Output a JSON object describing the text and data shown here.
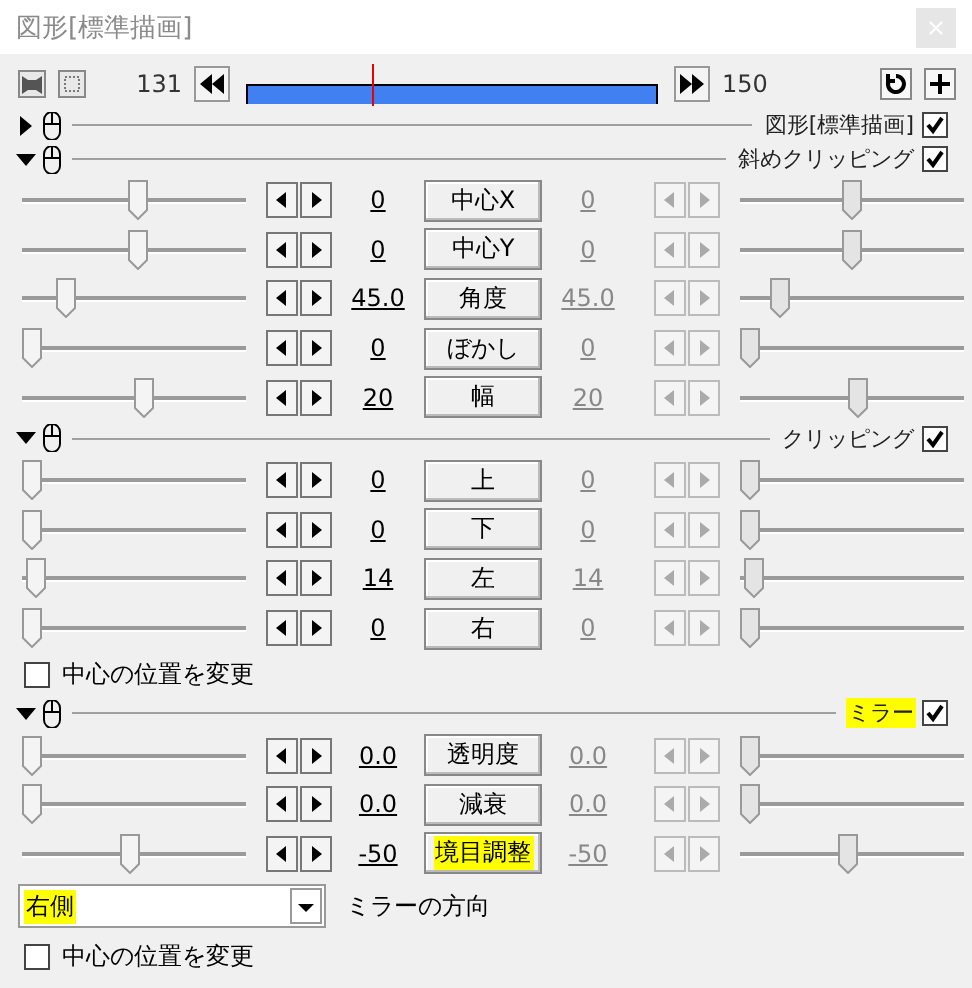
{
  "window": {
    "title": "図形[標準描画]"
  },
  "toolbar": {
    "start_frame": "131",
    "end_frame": "150",
    "playhead": {
      "level": 0.31
    }
  },
  "sections": [
    {
      "name": "図形[標準描画]",
      "expanded": false,
      "checked": true,
      "highlighted": false
    },
    {
      "name": "斜めクリッピング",
      "expanded": true,
      "checked": true,
      "highlighted": false,
      "items": [
        {
          "kind": "slider",
          "label": "中心X",
          "highlighted": false,
          "start": {
            "value": "0",
            "level": 0.52,
            "disabled": false
          },
          "end": {
            "value": "0",
            "level": 0.5,
            "disabled": true
          }
        },
        {
          "kind": "slider",
          "label": "中心Y",
          "highlighted": false,
          "start": {
            "value": "0",
            "level": 0.52,
            "disabled": false
          },
          "end": {
            "value": "0",
            "level": 0.5,
            "disabled": true
          }
        },
        {
          "kind": "slider",
          "label": "角度",
          "highlighted": false,
          "start": {
            "value": "45.0",
            "level": 0.17,
            "disabled": false
          },
          "end": {
            "value": "45.0",
            "level": 0.15,
            "disabled": true
          }
        },
        {
          "kind": "slider",
          "label": "ぼかし",
          "highlighted": false,
          "start": {
            "value": "0",
            "level": 0,
            "disabled": false
          },
          "end": {
            "value": "0",
            "level": 0,
            "disabled": true
          }
        },
        {
          "kind": "slider",
          "label": "幅",
          "highlighted": false,
          "start": {
            "value": "20",
            "level": 0.55,
            "disabled": false
          },
          "end": {
            "value": "20",
            "level": 0.53,
            "disabled": true
          }
        }
      ]
    },
    {
      "name": "クリッピング",
      "expanded": true,
      "checked": true,
      "highlighted": false,
      "items": [
        {
          "kind": "slider",
          "label": "上",
          "highlighted": false,
          "start": {
            "value": "0",
            "level": 0,
            "disabled": false
          },
          "end": {
            "value": "0",
            "level": 0,
            "disabled": true
          }
        },
        {
          "kind": "slider",
          "label": "下",
          "highlighted": false,
          "start": {
            "value": "0",
            "level": 0,
            "disabled": false
          },
          "end": {
            "value": "0",
            "level": 0,
            "disabled": true
          }
        },
        {
          "kind": "slider",
          "label": "左",
          "highlighted": false,
          "start": {
            "value": "14",
            "level": 0.02,
            "disabled": false
          },
          "end": {
            "value": "14",
            "level": 0.02,
            "disabled": true
          }
        },
        {
          "kind": "slider",
          "label": "右",
          "highlighted": false,
          "start": {
            "value": "0",
            "level": 0,
            "disabled": false
          },
          "end": {
            "value": "0",
            "level": 0,
            "disabled": true
          }
        },
        {
          "kind": "checkbox",
          "label": "中心の位置を変更",
          "checked": false
        }
      ]
    },
    {
      "name": "ミラー",
      "expanded": true,
      "checked": true,
      "highlighted": true,
      "items": [
        {
          "kind": "slider",
          "label": "透明度",
          "highlighted": false,
          "start": {
            "value": "0.0",
            "level": 0,
            "disabled": false
          },
          "end": {
            "value": "0.0",
            "level": 0,
            "disabled": true
          }
        },
        {
          "kind": "slider",
          "label": "減衰",
          "highlighted": false,
          "start": {
            "value": "0.0",
            "level": 0,
            "disabled": false
          },
          "end": {
            "value": "0.0",
            "level": 0,
            "disabled": true
          }
        },
        {
          "kind": "slider",
          "label": "境目調整",
          "highlighted": true,
          "start": {
            "value": "-50",
            "level": 0.48,
            "disabled": false
          },
          "end": {
            "value": "-50",
            "level": 0.48,
            "disabled": true
          }
        },
        {
          "kind": "dropdown",
          "value": "右側",
          "highlighted": true,
          "caption": "ミラーの方向"
        },
        {
          "kind": "checkbox",
          "label": "中心の位置を変更",
          "checked": false
        }
      ]
    }
  ]
}
